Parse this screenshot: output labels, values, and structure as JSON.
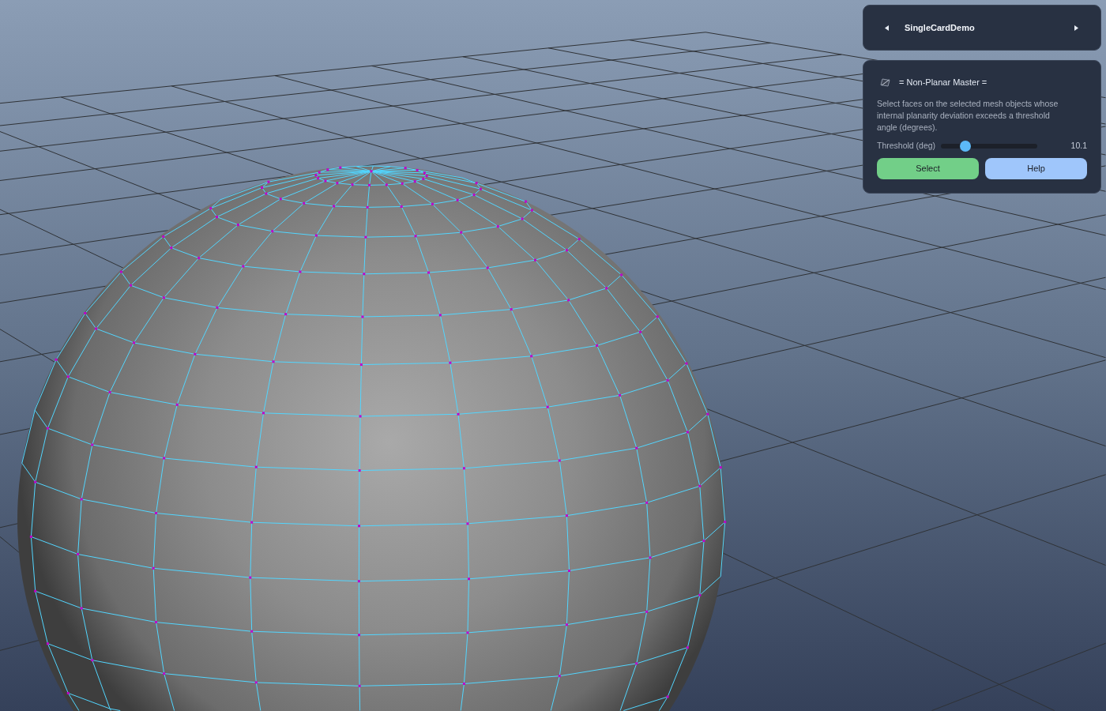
{
  "card_switcher": {
    "title": "SingleCardDemo"
  },
  "tool_card": {
    "title": "= Non-Planar Master =",
    "description": "Select faces on the selected mesh objects whose internal planarity deviation exceeds a threshold angle (degrees).",
    "slider": {
      "label": "Threshold (deg)",
      "level": 0.25,
      "reading": "10.1"
    },
    "buttons": [
      {
        "label": "Select",
        "kind": "action"
      },
      {
        "label": "Help",
        "kind": "help"
      }
    ]
  }
}
